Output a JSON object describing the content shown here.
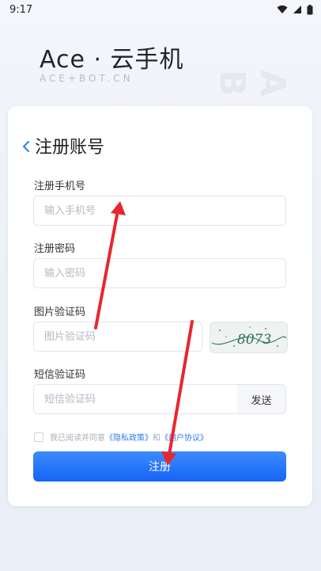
{
  "status_bar": {
    "time": "9:17"
  },
  "brand": {
    "title": "Ace · 云手机",
    "subtitle": "ACE+BOT.CN",
    "watermark": "ACE-BOT.CN"
  },
  "form": {
    "title": "注册账号",
    "phone": {
      "label": "注册手机号",
      "placeholder": "输入手机号"
    },
    "password": {
      "label": "注册密码",
      "placeholder": "输入密码"
    },
    "image_code": {
      "label": "图片验证码",
      "placeholder": "图片验证码",
      "captcha_text": "8073"
    },
    "sms_code": {
      "label": "短信验证码",
      "placeholder": "短信验证码",
      "send_label": "发送"
    },
    "agreement": {
      "prefix": "我已阅读并同意",
      "privacy": "《隐私政策》",
      "and": "和",
      "user_agreement": "《用户协议》"
    },
    "submit_label": "注册"
  },
  "colors": {
    "accent": "#1664f5",
    "annotation_arrow": "#e8262f"
  }
}
